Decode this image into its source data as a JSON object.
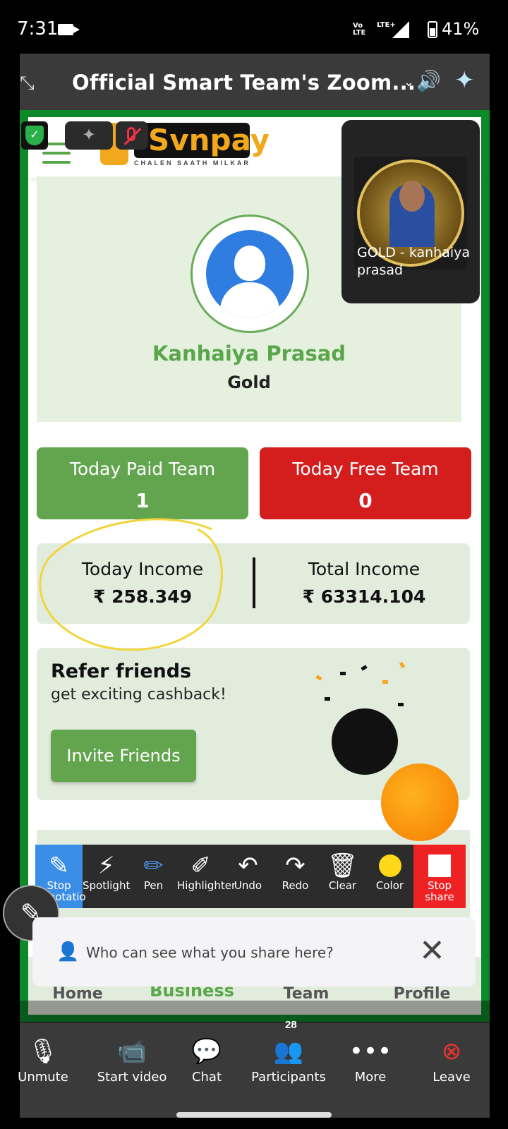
{
  "status_bar": {
    "time": "7:31",
    "volte": "Vo\nLTE",
    "lte": "LTE+",
    "battery": "41%"
  },
  "zoom": {
    "title": "Official Smart Team's Zoom...",
    "participant_count": "28"
  },
  "app": {
    "logo_text": "Svnpay",
    "logo_tagline": "CHALEN SAATH MILKAR",
    "profile": {
      "name": "Kanhaiya Prasad",
      "rank": "Gold"
    },
    "paid_team": {
      "label": "Today Paid Team",
      "value": "1"
    },
    "free_team": {
      "label": "Today Free Team",
      "value": "0"
    },
    "today_income": {
      "label": "Today Income",
      "value": "₹ 258.349"
    },
    "total_income": {
      "label": "Total Income",
      "value": "₹ 63314.104"
    },
    "refer": {
      "title": "Refer friends",
      "subtitle": "get exciting cashback!",
      "button": "Invite Friends"
    },
    "tabs": [
      "Home",
      "Business",
      "Team",
      "Profile"
    ]
  },
  "pip": {
    "name": "GOLD - kanhaiya prasad"
  },
  "annotation_tools": [
    "Stop annotatio",
    "Spotlight",
    "Pen",
    "Highlighter",
    "Undo",
    "Redo",
    "Clear",
    "Color",
    "Stop share"
  ],
  "notice": {
    "text": "Who can see what you share here?"
  },
  "bottom_bar": [
    "Unmute",
    "Start video",
    "Chat",
    "Participants",
    "More",
    "Leave"
  ],
  "colors": {
    "green": "#63a54e",
    "red": "#d41e1e",
    "zoom_dark": "#3a3a3a",
    "highlight": "#f2d53c"
  }
}
